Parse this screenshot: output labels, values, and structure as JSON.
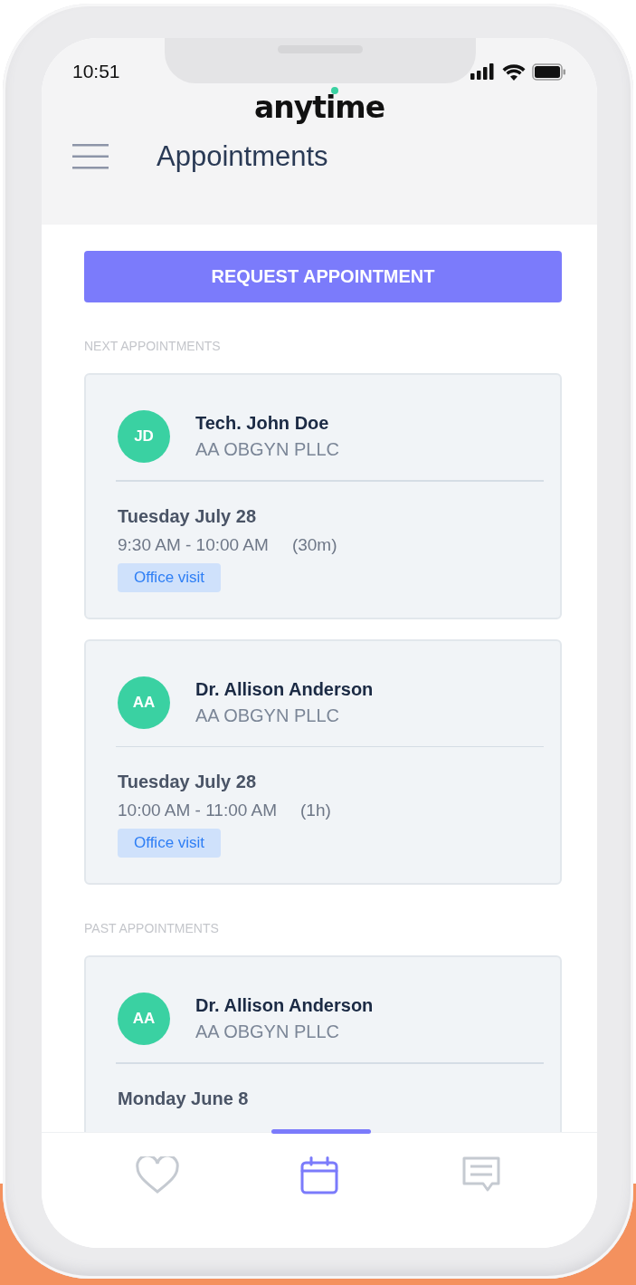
{
  "status_bar": {
    "time": "10:51"
  },
  "header": {
    "logo": "anytime",
    "title": "Appointments"
  },
  "request_button": "REQUEST APPOINTMENT",
  "sections": [
    {
      "heading": "NEXT APPOINTMENTS",
      "appointments": [
        {
          "initials": "JD",
          "color": "#3ad1a2",
          "name": "Tech. John Doe",
          "clinic": "AA OBGYN PLLC",
          "date": "Tuesday July 28",
          "time": "9:30 AM - 10:00 AM",
          "duration": "(30m)",
          "type": "Office visit"
        },
        {
          "initials": "AA",
          "color": "#3ad1a2",
          "name": "Dr. Allison Anderson",
          "clinic": "AA OBGYN PLLC",
          "date": "Tuesday July 28",
          "time": "10:00 AM - 11:00 AM",
          "duration": "(1h)",
          "type": "Office visit"
        }
      ]
    },
    {
      "heading": "PAST APPOINTMENTS",
      "appointments": [
        {
          "initials": "AA",
          "color": "#3ad1a2",
          "name": "Dr. Allison Anderson",
          "clinic": "AA OBGYN PLLC",
          "date": "Monday June 8"
        }
      ]
    }
  ],
  "bottom_nav": [
    {
      "kind": "heart",
      "selected": false
    },
    {
      "kind": "calendar",
      "selected": true
    },
    {
      "kind": "chat",
      "selected": false
    }
  ]
}
